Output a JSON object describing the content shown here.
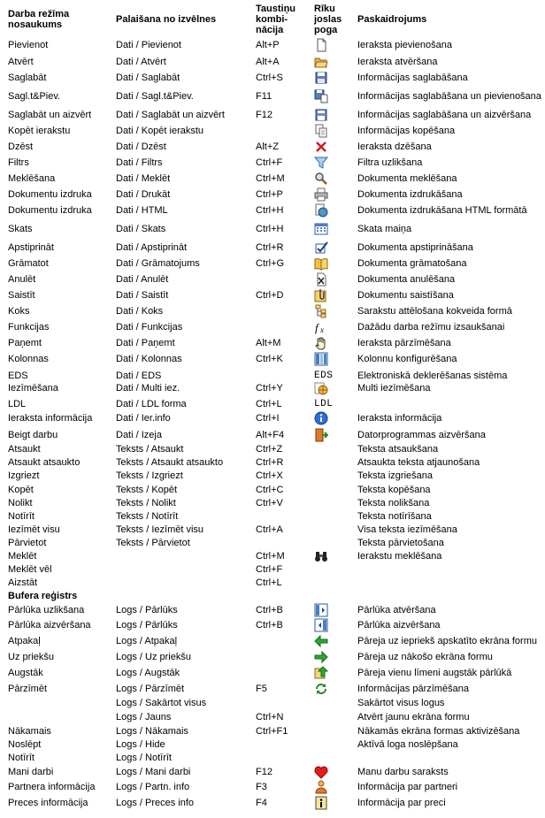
{
  "headers": {
    "mode_l1": "Darba režīma",
    "mode_l2": "nosaukums",
    "menu": "Palaišana no izvēlnes",
    "keys_l1": "Taustiņu",
    "keys_l2": "kombi-",
    "keys_l3": "nācija",
    "tool_l1": "Rīku",
    "tool_l2": "joslas",
    "tool_l3": "poga",
    "desc": "Paskaidrojums"
  },
  "rows": [
    {
      "mode": "Pievienot",
      "menu": "Dati / Pievienot",
      "keys": "Alt+P",
      "icon": "new-document-icon",
      "desc": "Ieraksta pievienošana"
    },
    {
      "mode": "Atvērt",
      "menu": "Dati / Atvērt",
      "keys": "Alt+A",
      "icon": "open-folder-icon",
      "desc": "Ieraksta atvēršana"
    },
    {
      "mode": "Saglabāt",
      "menu": "Dati / Saglabāt",
      "keys": "Ctrl+S",
      "icon": "floppy-disk-icon",
      "desc": "Informācijas saglabāšana"
    },
    {
      "mode": "Sagl.t&Piev.",
      "menu": "Dati / Sagl.t&Piev.",
      "keys": "F11",
      "icon": "save-and-add-icon",
      "desc": "Informācijas saglabāšana un pievienošana"
    },
    {
      "mode": "Saglabāt un aizvērt",
      "menu": "Dati / Saglabāt un aizvērt",
      "keys": "F12",
      "icon": "save-close-icon",
      "desc": "Informācijas saglabāšana un aizvēršana"
    },
    {
      "mode": "Kopēt ierakstu",
      "menu": "Dati / Kopēt ierakstu",
      "keys": "",
      "icon": "copy-record-icon",
      "desc": "Informācijas kopēšana"
    },
    {
      "mode": "Dzēst",
      "menu": "Dati / Dzēst",
      "keys": "Alt+Z",
      "icon": "delete-x-icon",
      "desc": "Ieraksta dzēšana"
    },
    {
      "mode": "Filtrs",
      "menu": "Dati / Filtrs",
      "keys": "Ctrl+F",
      "icon": "funnel-filter-icon",
      "desc": "Filtra uzlikšana"
    },
    {
      "mode": "Meklēšana",
      "menu": "Dati / Meklēt",
      "keys": "Ctrl+M",
      "icon": "magnifier-icon",
      "desc": "Dokumenta meklēšana"
    },
    {
      "mode": "Dokumentu izdruka",
      "menu": "Dati / Drukāt",
      "keys": "Ctrl+P",
      "icon": "printer-icon",
      "desc": "Dokumenta izdrukāšana"
    },
    {
      "mode": "Dokumentu izdruka",
      "menu": "Dati / HTML",
      "keys": "Ctrl+H",
      "icon": "html-globe-icon",
      "desc": "Dokumenta izdrukāšana HTML formātā"
    },
    {
      "mode": "Skats",
      "menu": "Dati / Skats",
      "keys": "Ctrl+H",
      "icon": "grid-view-icon",
      "desc": "Skata maiņa"
    },
    {
      "mode": "Apstiprināt",
      "menu": "Dati / Apstiprināt",
      "keys": "Ctrl+R",
      "icon": "checkmark-icon",
      "desc": "Dokumenta apstiprināšana"
    },
    {
      "mode": "Grāmatot",
      "menu": "Dati / Grāmatojums",
      "keys": "Ctrl+G",
      "icon": "book-icon",
      "desc": "Dokumenta grāmatošana"
    },
    {
      "mode": "Anulēt",
      "menu": "Dati / Anulēt",
      "keys": "",
      "icon": "cancel-document-icon",
      "desc": "Dokumenta anulēšana"
    },
    {
      "mode": "Saistīt",
      "menu": "Dati / Saistīt",
      "keys": "Ctrl+D",
      "icon": "paperclip-icon",
      "desc": "Dokumentu saistīšana"
    },
    {
      "mode": "Koks",
      "menu": "Dati / Koks",
      "keys": "",
      "icon": "tree-view-icon",
      "desc": "Sarakstu attēlošana kokveida formā"
    },
    {
      "mode": "Funkcijas",
      "menu": "Dati / Funkcijas",
      "keys": "",
      "icon": "function-fx-icon",
      "desc": "Dažādu darba režīmu izsaukšanai"
    },
    {
      "mode": "Paņemt",
      "menu": "Dati / Paņemt",
      "keys": "Alt+M",
      "icon": "hand-grab-icon",
      "desc": "Ieraksta pārzīmēšana"
    },
    {
      "mode": "Kolonnas",
      "menu": "Dati / Kolonnas",
      "keys": "Ctrl+K",
      "icon": "columns-icon",
      "desc": "Kolonnu konfigurēšana"
    },
    {
      "mode": "EDS",
      "menu": "Dati / EDS",
      "keys": "",
      "icon": "eds-text-icon",
      "icon_text": "EDS",
      "desc": "Elektroniskā deklerēšanas sistēma"
    },
    {
      "mode": "Iezīmēšana",
      "menu": "Dati / Multi iez.",
      "keys": "Ctrl+Y",
      "icon": "multi-select-icon",
      "desc": "Multi iezīmēšana"
    },
    {
      "mode": "LDL",
      "menu": "Dati / LDL forma",
      "keys": "Ctrl+L",
      "icon": "ldl-text-icon",
      "icon_text": "LDL",
      "desc": ""
    },
    {
      "mode": "Ieraksta informācija",
      "menu": "Dati / Ier.info",
      "keys": "Ctrl+I",
      "icon": "info-circle-icon",
      "desc": "Ieraksta informācija"
    },
    {
      "mode": "Beigt darbu",
      "menu": "Dati / Izeja",
      "keys": "Alt+F4",
      "icon": "exit-door-icon",
      "desc": "Datorprogrammas aizvēršana"
    },
    {
      "mode": "Atsaukt",
      "menu": "Teksts / Atsaukt",
      "keys": "Ctrl+Z",
      "icon": "",
      "desc": "Teksta atsaukšana"
    },
    {
      "mode": "Atsaukt atsaukto",
      "menu": "Teksts / Atsaukt atsaukto",
      "keys": "Ctrl+R",
      "icon": "",
      "desc": "Atsaukta teksta atjaunošana"
    },
    {
      "mode": "Izgriezt",
      "menu": "Teksts / Izgriezt",
      "keys": "Ctrl+X",
      "icon": "",
      "desc": "Teksta izgriešana"
    },
    {
      "mode": "Kopēt",
      "menu": "Teksts /  Kopēt",
      "keys": "Ctrl+C",
      "icon": "",
      "desc": "Teksta kopēšana"
    },
    {
      "mode": "Nolikt",
      "menu": "Teksts / Nolikt",
      "keys": "Ctrl+V",
      "icon": "",
      "desc": "Teksta nolikšana"
    },
    {
      "mode": "Notīrīt",
      "menu": "Teksts / Notīrīt",
      "keys": "",
      "icon": "",
      "desc": "Teksta notīrīšana"
    },
    {
      "mode": "Iezīmēt visu",
      "menu": "Teksts / Iezīmēt visu",
      "keys": "Ctrl+A",
      "icon": "",
      "desc": "Visa teksta iezīmēšana"
    },
    {
      "mode": "Pārvietot",
      "menu": "Teksts / Pārvietot",
      "keys": "",
      "icon": "",
      "desc": "Teksta pārvietošana"
    },
    {
      "mode": "Meklēt",
      "menu": "",
      "keys": "Ctrl+M",
      "icon": "binoculars-icon",
      "desc": "Ierakstu meklēšana"
    },
    {
      "mode": "Meklēt vēl",
      "menu": "",
      "keys": "Ctrl+F",
      "icon": "",
      "desc": ""
    },
    {
      "mode": "Aizstāt",
      "menu": "",
      "keys": "Ctrl+L",
      "icon": "",
      "desc": ""
    },
    {
      "mode": "Bufera reģistrs",
      "section": true,
      "menu": "",
      "keys": "",
      "icon": "",
      "desc": ""
    },
    {
      "mode": "Pārlūka uzlikšana",
      "menu": "Logs / Pārlūks",
      "keys": "Ctrl+B",
      "icon": "browser-open-icon",
      "desc": "Pārlūka atvēršana"
    },
    {
      "mode": "Pārlūka aizvēršana",
      "menu": "Logs / Pārlūks",
      "keys": "Ctrl+B",
      "icon": "browser-close-icon",
      "desc": "Pārlūka aizvēršana"
    },
    {
      "mode": "Atpakaļ",
      "menu": "Logs / Atpakaļ",
      "keys": "",
      "icon": "arrow-left-icon",
      "desc": "Pāreja uz iepriekš apskatīto ekrāna formu"
    },
    {
      "mode": "Uz priekšu",
      "menu": "Logs / Uz priekšu",
      "keys": "",
      "icon": "arrow-right-icon",
      "desc": "Pāreja uz nākošo ekrāna formu"
    },
    {
      "mode": "Augstāk",
      "menu": "Logs / Augstāk",
      "keys": "",
      "icon": "level-up-icon",
      "desc": "Pāreja vienu līmeni augstāk pārlūkā"
    },
    {
      "mode": "Pārzīmēt",
      "menu": "Logs / Pārzīmēt",
      "keys": "F5",
      "icon": "refresh-icon",
      "desc": "Informācijas pārzīmēšana"
    },
    {
      "mode": "",
      "menu": "Logs / Sakārtot visus",
      "keys": "",
      "icon": "",
      "desc": "Sakārtot visus logus"
    },
    {
      "mode": "",
      "menu": "Logs / Jauns",
      "keys": "Ctrl+N",
      "icon": "",
      "desc": "Atvērt jaunu ekrāna formu"
    },
    {
      "mode": "Nākamais",
      "menu": "Logs / Nākamais",
      "keys": "Ctrl+F1",
      "icon": "",
      "desc": "Nākamās ekrāna formas aktivizēšana"
    },
    {
      "mode": "Noslēpt",
      "menu": "Logs / Hide",
      "keys": "",
      "icon": "",
      "desc": "Aktīvā loga noslēpšana"
    },
    {
      "mode": "Notīrīt",
      "menu": "Logs / Notīrīt",
      "keys": "",
      "icon": "",
      "desc": ""
    },
    {
      "mode": "Mani darbi",
      "menu": "Logs / Mani darbi",
      "keys": "F12",
      "icon": "heart-icon",
      "desc": "Manu darbu saraksts"
    },
    {
      "mode": "Partnera informācija",
      "menu": "Logs / Partn. info",
      "keys": "F3",
      "icon": "partner-person-icon",
      "desc": "Informācija par partneri"
    },
    {
      "mode": "Preces informācija",
      "menu": "Logs / Preces info",
      "keys": "F4",
      "icon": "product-info-icon",
      "desc": "Informācija par preci"
    }
  ]
}
